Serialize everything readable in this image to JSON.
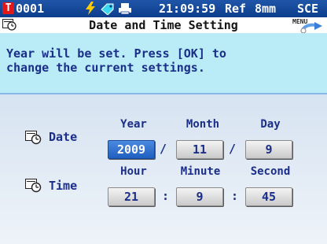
{
  "status_bar": {
    "channel_badge": "T",
    "channel_code": "0001",
    "time": "21:09:59",
    "ref_label": "Ref",
    "aperture": "8mm",
    "specular": "SCE",
    "icons": [
      "lightning-icon",
      "tag-icon",
      "printer-icon"
    ]
  },
  "title_bar": {
    "title": "Date and Time Setting",
    "menu_label": "MENU"
  },
  "message": {
    "line1": "Year will be set. Press [OK] to",
    "line2": "change the current settings."
  },
  "date_row": {
    "label": "Date",
    "headers": [
      "Year",
      "Month",
      "Day"
    ],
    "year": "2009",
    "month": "11",
    "day": "9",
    "separator": "/"
  },
  "time_row": {
    "label": "Time",
    "headers": [
      "Hour",
      "Minute",
      "Second"
    ],
    "hour": "21",
    "minute": "9",
    "second": "45",
    "separator": ":"
  },
  "colors": {
    "status_bar": "#1f55a8",
    "message_bg": "#b9ecf6",
    "text": "#1a2e8a",
    "selected_field": "#2f70d0"
  }
}
